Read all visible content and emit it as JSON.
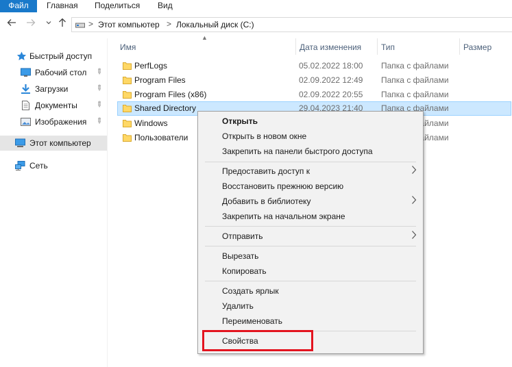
{
  "ribbon": {
    "tabs": [
      "Файл",
      "Главная",
      "Поделиться",
      "Вид"
    ]
  },
  "navigation": {
    "back_icon": "arrow-left-icon",
    "forward_icon": "arrow-right-icon",
    "recent_icon": "chevron-down-icon",
    "up_icon": "arrow-up-icon"
  },
  "address": {
    "crumbs": [
      "Этот компьютер",
      "Локальный диск (C:)"
    ],
    "separator": ">"
  },
  "sidebar": {
    "items": [
      {
        "label": "Быстрый доступ",
        "icon": "star-icon"
      },
      {
        "label": "Рабочий стол",
        "icon": "desktop-icon",
        "pinned": true
      },
      {
        "label": "Загрузки",
        "icon": "download-icon",
        "pinned": true
      },
      {
        "label": "Документы",
        "icon": "document-icon",
        "pinned": true
      },
      {
        "label": "Изображения",
        "icon": "pictures-icon",
        "pinned": true
      },
      {
        "label": "Этот компьютер",
        "icon": "computer-icon",
        "selected": true
      },
      {
        "label": "Сеть",
        "icon": "network-icon"
      }
    ]
  },
  "columns": {
    "name": "Имя",
    "date": "Дата изменения",
    "type": "Тип",
    "size": "Размер"
  },
  "files": [
    {
      "name": "PerfLogs",
      "date": "05.02.2022 18:00",
      "type": "Папка с файлами"
    },
    {
      "name": "Program Files",
      "date": "02.09.2022 12:49",
      "type": "Папка с файлами"
    },
    {
      "name": "Program Files (x86)",
      "date": "02.09.2022 20:55",
      "type": "Папка с файлами"
    },
    {
      "name": "Shared Directory",
      "date": "29.04.2023 21:40",
      "type": "Папка с файлами",
      "selected": true
    },
    {
      "name": "Windows",
      "date": "",
      "type": "Папка с файлами"
    },
    {
      "name": "Пользователи",
      "date": "",
      "type": "Папка с файлами"
    }
  ],
  "context_menu": {
    "items": [
      {
        "label": "Открыть",
        "bold": true
      },
      {
        "label": "Открыть в новом окне"
      },
      {
        "label": "Закрепить на панели быстрого доступа"
      },
      {
        "label": "Предоставить доступ к",
        "submenu": true
      },
      {
        "label": "Восстановить прежнюю версию"
      },
      {
        "label": "Добавить в библиотеку",
        "submenu": true
      },
      {
        "label": "Закрепить на начальном экране"
      },
      {
        "label": "Отправить",
        "submenu": true
      },
      {
        "label": "Вырезать"
      },
      {
        "label": "Копировать"
      },
      {
        "label": "Создать ярлык"
      },
      {
        "label": "Удалить"
      },
      {
        "label": "Переименовать"
      },
      {
        "label": "Свойства",
        "highlighted": true
      }
    ],
    "highlight_color": "#e3141f"
  },
  "colors": {
    "file_tab": "#1979ca",
    "selection": "#cce8ff",
    "selection_border": "#99d1ff",
    "folder": "#ffd866"
  }
}
